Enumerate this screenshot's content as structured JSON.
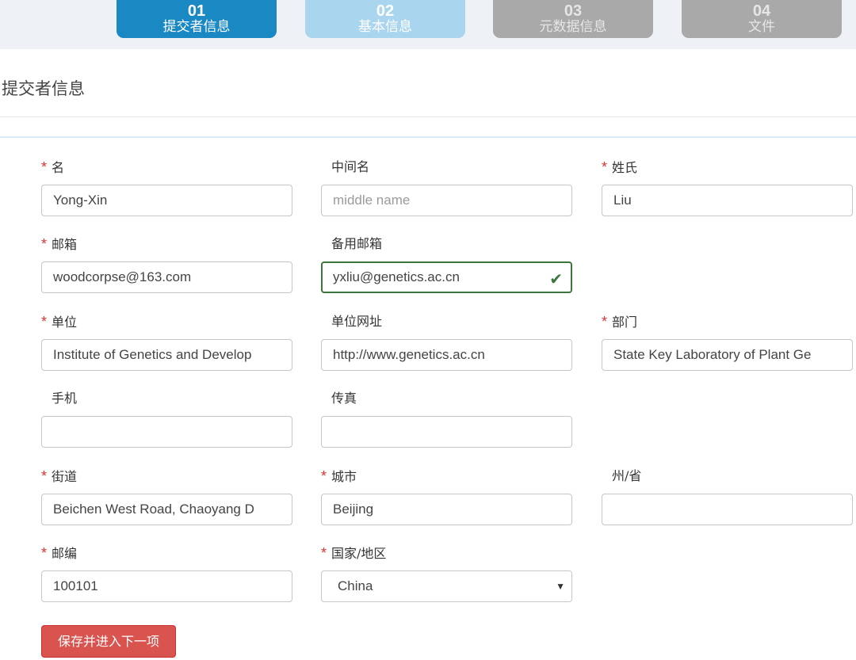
{
  "steps": [
    {
      "num": "01",
      "label": "提交者信息"
    },
    {
      "num": "02",
      "label": "基本信息"
    },
    {
      "num": "03",
      "label": "元数据信息"
    },
    {
      "num": "04",
      "label": "文件"
    }
  ],
  "section_title": "提交者信息",
  "required_mark": "*",
  "fields": {
    "first_name": {
      "label": "名",
      "value": "Yong-Xin"
    },
    "middle_name": {
      "label": "中间名",
      "placeholder": "middle name"
    },
    "last_name": {
      "label": "姓氏",
      "value": "Liu"
    },
    "email": {
      "label": "邮箱",
      "value": "woodcorpse@163.com"
    },
    "alt_email": {
      "label": "备用邮箱",
      "value": "yxliu@genetics.ac.cn"
    },
    "organization": {
      "label": "单位",
      "value": "Institute of Genetics and Develop"
    },
    "org_url": {
      "label": "单位网址",
      "value": "http://www.genetics.ac.cn"
    },
    "department": {
      "label": "部门",
      "value": "State Key Laboratory of Plant Ge"
    },
    "mobile": {
      "label": "手机",
      "value": ""
    },
    "fax": {
      "label": "传真",
      "value": ""
    },
    "street": {
      "label": "街道",
      "value": "Beichen West Road, Chaoyang D"
    },
    "city": {
      "label": "城市",
      "value": "Beijing"
    },
    "state": {
      "label": "州/省",
      "value": ""
    },
    "postcode": {
      "label": "邮编",
      "value": "100101"
    },
    "country": {
      "label": "国家/地区",
      "value": "China"
    }
  },
  "icons": {
    "valid": "checkmark-icon",
    "select": "caret-down-icon"
  },
  "colors": {
    "step_active": "#1a88c3",
    "step_next": "#a9d5ee",
    "step_inactive": "#a9a9a9",
    "required": "#d9322f",
    "valid_border": "#3c763d",
    "submit": "#d9534f"
  },
  "submit_label": "保存并进入下一项"
}
